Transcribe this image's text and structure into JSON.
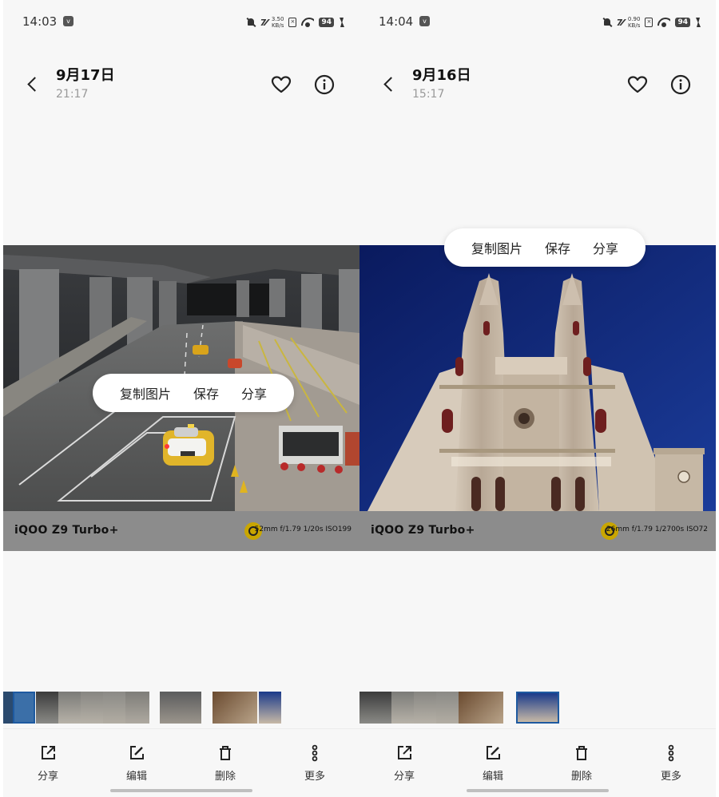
{
  "colors": {
    "accent": "#c9a600",
    "watermark_bg": "#8c8c8c",
    "panel_bg": "#f7f7f7"
  },
  "left": {
    "status": {
      "time": "14:03",
      "speed_top": "3.50",
      "speed_bottom": "KB/s",
      "battery": "94"
    },
    "header": {
      "date": "9月17日",
      "time": "21:17"
    },
    "popup": {
      "copy": "复制图片",
      "save": "保存",
      "share": "分享"
    },
    "watermark": {
      "model": "iQOO Z9 Turbo+",
      "params": "52mm  f/1.79  1/20s  ISO199"
    },
    "actions": [
      {
        "label": "分享",
        "icon": "share-icon"
      },
      {
        "label": "编辑",
        "icon": "edit-icon"
      },
      {
        "label": "删除",
        "icon": "delete-icon"
      },
      {
        "label": "更多",
        "icon": "more-icon"
      }
    ]
  },
  "right": {
    "status": {
      "time": "14:04",
      "speed_top": "0.90",
      "speed_bottom": "KB/s",
      "battery": "94"
    },
    "header": {
      "date": "9月16日",
      "time": "15:17"
    },
    "popup": {
      "copy": "复制图片",
      "save": "保存",
      "share": "分享"
    },
    "watermark": {
      "model": "iQOO Z9 Turbo+",
      "params": "26mm  f/1.79  1/2700s  ISO72"
    },
    "actions": [
      {
        "label": "分享",
        "icon": "share-icon"
      },
      {
        "label": "编辑",
        "icon": "edit-icon"
      },
      {
        "label": "删除",
        "icon": "delete-icon"
      },
      {
        "label": "更多",
        "icon": "more-icon"
      }
    ]
  }
}
